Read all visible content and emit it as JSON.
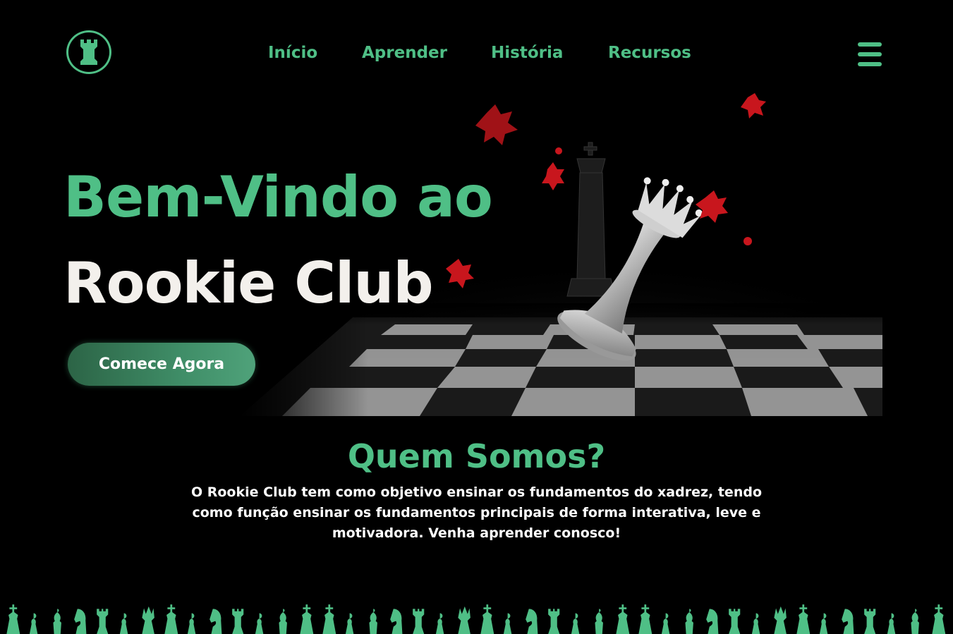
{
  "header": {
    "logo_icon": "rook-icon",
    "nav": [
      {
        "label": "Início"
      },
      {
        "label": "Aprender"
      },
      {
        "label": "História"
      },
      {
        "label": "Recursos"
      }
    ],
    "menu_icon": "hamburger-menu-icon"
  },
  "hero": {
    "title_line1": "Bem-Vindo ao",
    "title_line2": "Rookie Club",
    "cta_label": "Comece Agora",
    "image": "fallen-white-queen-on-chessboard-with-red-petals"
  },
  "about": {
    "title": "Quem Somos?",
    "text": "O Rookie Club tem como objetivo ensinar os fundamentos do xadrez, tendo como função ensinar os fundamentos principais de forma interativa, leve e motivadora. Venha aprender conosco!"
  },
  "footer": {
    "decoration": "chess-pieces-border"
  },
  "colors": {
    "accent": "#4fbf86",
    "background": "#000000",
    "title_white": "#f3f0ec",
    "button_dark": "#2c6446",
    "petals": "#c8161d"
  }
}
